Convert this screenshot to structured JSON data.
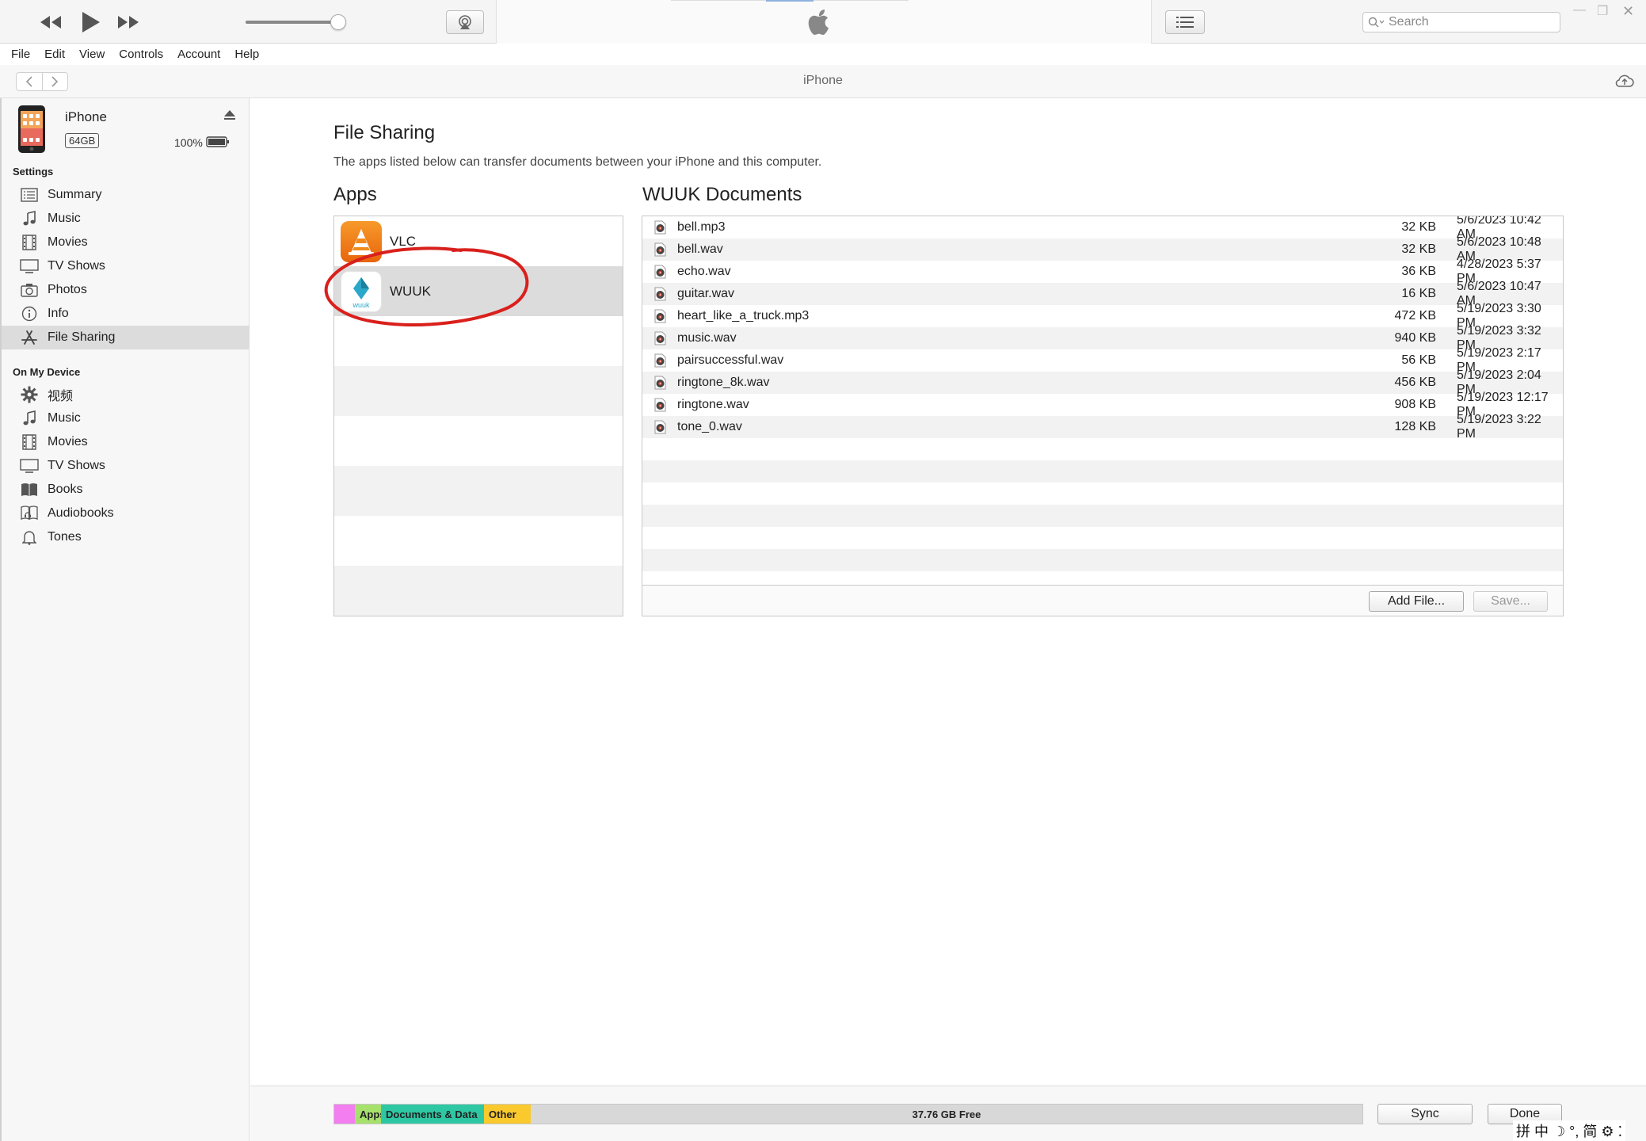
{
  "window": {
    "search_placeholder": "Search",
    "accent_color": "#0a64d6"
  },
  "menu": [
    "File",
    "Edit",
    "View",
    "Controls",
    "Account",
    "Help"
  ],
  "nav": {
    "title": "iPhone"
  },
  "device": {
    "name": "iPhone",
    "capacity": "64GB",
    "battery": "100%"
  },
  "sidebar": {
    "settings_heading": "Settings",
    "settings_items": [
      {
        "label": "Summary",
        "icon": "summary-icon"
      },
      {
        "label": "Music",
        "icon": "music-note-icon"
      },
      {
        "label": "Movies",
        "icon": "film-icon"
      },
      {
        "label": "TV Shows",
        "icon": "tv-icon"
      },
      {
        "label": "Photos",
        "icon": "camera-icon"
      },
      {
        "label": "Info",
        "icon": "info-icon"
      },
      {
        "label": "File Sharing",
        "icon": "app-store-icon",
        "active": true
      }
    ],
    "device_heading": "On My Device",
    "device_items": [
      {
        "label": "视频",
        "icon": "gear-icon"
      },
      {
        "label": "Music",
        "icon": "music-note-icon"
      },
      {
        "label": "Movies",
        "icon": "film-icon"
      },
      {
        "label": "TV Shows",
        "icon": "tv-icon"
      },
      {
        "label": "Books",
        "icon": "book-icon"
      },
      {
        "label": "Audiobooks",
        "icon": "audiobook-icon"
      },
      {
        "label": "Tones",
        "icon": "bell-icon"
      }
    ]
  },
  "main": {
    "title": "File Sharing",
    "description": "The apps listed below can transfer documents between your iPhone and this computer.",
    "apps_heading": "Apps",
    "docs_heading": "WUUK Documents",
    "apps": [
      {
        "name": "VLC",
        "selected": false
      },
      {
        "name": "WUUK",
        "selected": true
      }
    ],
    "documents": [
      {
        "name": "bell.mp3",
        "size": "32 KB",
        "date": "5/6/2023 10:42 AM"
      },
      {
        "name": "bell.wav",
        "size": "32 KB",
        "date": "5/6/2023 10:48 AM"
      },
      {
        "name": "echo.wav",
        "size": "36 KB",
        "date": "4/28/2023 5:37 PM"
      },
      {
        "name": "guitar.wav",
        "size": "16 KB",
        "date": "5/6/2023 10:47 AM"
      },
      {
        "name": "heart_like_a_truck.mp3",
        "size": "472 KB",
        "date": "5/19/2023 3:30 PM"
      },
      {
        "name": "music.wav",
        "size": "940 KB",
        "date": "5/19/2023 3:32 PM"
      },
      {
        "name": "pairsuccessful.wav",
        "size": "56 KB",
        "date": "5/19/2023 2:17 PM"
      },
      {
        "name": "ringtone_8k.wav",
        "size": "456 KB",
        "date": "5/19/2023 2:04 PM"
      },
      {
        "name": "ringtone.wav",
        "size": "908 KB",
        "date": "5/19/2023 12:17 PM"
      },
      {
        "name": "tone_0.wav",
        "size": "128 KB",
        "date": "5/19/2023 3:22 PM"
      }
    ],
    "add_file_label": "Add File...",
    "save_label": "Save..."
  },
  "capacity": {
    "segments": [
      {
        "label": "",
        "color": "#f27ef0",
        "fraction": 0.02
      },
      {
        "label": "Apps",
        "color": "#a6e16c",
        "fraction": 0.025
      },
      {
        "label": "Documents & Data",
        "color": "#2ec7a3",
        "fraction": 0.1
      },
      {
        "label": "Other",
        "color": "#f9c92e",
        "fraction": 0.045
      }
    ],
    "free_label": "37.76 GB Free",
    "free_color": "#d8d8d8",
    "sync_label": "Sync",
    "done_label": "Done"
  },
  "ime": "拼 中 ☽ °, 简 ⚙ ⁚"
}
